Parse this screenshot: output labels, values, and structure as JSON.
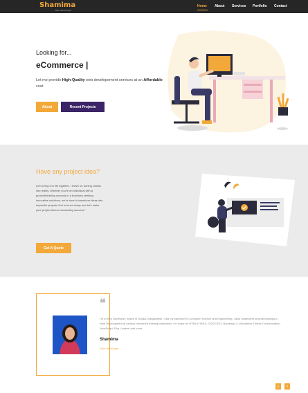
{
  "nav": {
    "logo": "Shamima",
    "logo_sub": "Web Developer",
    "items": [
      "Home",
      "About",
      "Services",
      "Portfolio",
      "Contact"
    ]
  },
  "hero": {
    "looking_for": "Looking for...",
    "typed": "eCommerce |",
    "intro_prefix": "Let me provide ",
    "intro_hq": "High-Quality",
    "intro_mid": " web developement services at an ",
    "intro_aff": "Affordable",
    "intro_suffix": " cost.",
    "about_btn": "About",
    "projects_btn": "Recent Projects"
  },
  "idea": {
    "heading": "Have any project idea?",
    "text": "Let's bring it to life together. I thrive on turning visions into reality. Whether you're an individual with a groundbreaking concept or a business seeking innovative solutions, we're here to transform ideas into impactful projects.Get in touch today and let's make your project idea a resounding success.\"",
    "quote_btn": "Get A Quote"
  },
  "testimonial": {
    "quote_glyph": "❝",
    "bio": "I'm a Web Developer, based in Dhaka, Bangladesh. I did my bachelor in Computer Science and Engineering. I also underwent several trainings in Web Development at various renowned training institutions. I'm expert in HTML/HTML5, CSS/CSS3, Bootstrap 4, Wordpress Theme Customization, JavaScript, Php, Laravel and more.",
    "name": "Shamima",
    "role": "Web Developer",
    "prev": "‹",
    "next": "›"
  },
  "colors": {
    "accent": "#f3a93a",
    "brand_dark": "#3b2566",
    "nav_bg": "#262626",
    "band_bg": "#ebebeb"
  }
}
